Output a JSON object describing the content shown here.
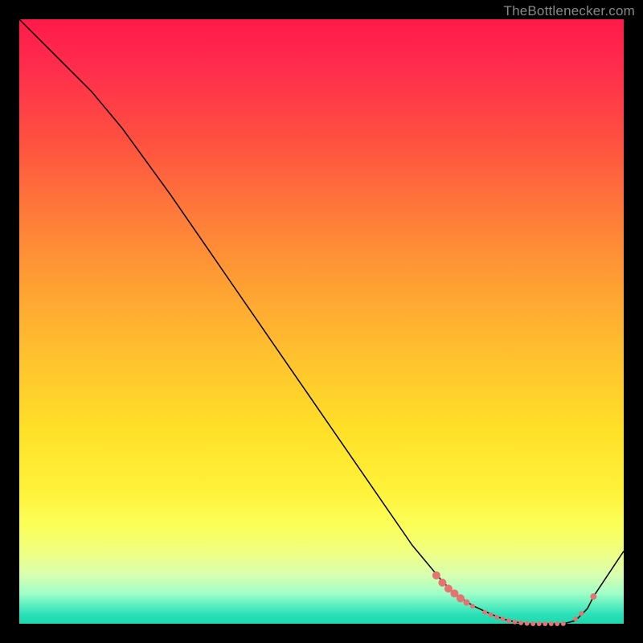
{
  "watermark": "TheBottlenecker.com",
  "chart_data": {
    "type": "line",
    "title": "",
    "xlabel": "",
    "ylabel": "",
    "xlim": [
      0,
      100
    ],
    "ylim": [
      0,
      100
    ],
    "x": [
      0,
      4,
      8,
      12,
      17,
      25,
      35,
      45,
      55,
      65,
      70,
      72,
      75,
      78,
      80,
      82,
      84,
      87,
      90,
      92,
      94,
      95,
      100
    ],
    "y": [
      100,
      96,
      92,
      88,
      82,
      71,
      56.5,
      42,
      27.5,
      13,
      7,
      5,
      3,
      1.6,
      0.8,
      0.3,
      0.0,
      0.0,
      0.0,
      0.5,
      2.5,
      4.5,
      12
    ],
    "series": [
      {
        "name": "curve",
        "x": [
          0,
          4,
          8,
          12,
          17,
          25,
          35,
          45,
          55,
          65,
          70,
          72,
          75,
          78,
          80,
          82,
          84,
          87,
          90,
          92,
          94,
          95,
          100
        ],
        "y": [
          100,
          96,
          92,
          88,
          82,
          71,
          56.5,
          42,
          27.5,
          13,
          7,
          5,
          3,
          1.6,
          0.8,
          0.3,
          0.0,
          0.0,
          0.0,
          0.5,
          2.5,
          4.5,
          12
        ]
      }
    ],
    "dots": [
      {
        "x": 69,
        "y": 8.0,
        "r": 5
      },
      {
        "x": 70,
        "y": 6.8,
        "r": 5
      },
      {
        "x": 71,
        "y": 5.8,
        "r": 5
      },
      {
        "x": 72,
        "y": 5.0,
        "r": 5
      },
      {
        "x": 73,
        "y": 4.2,
        "r": 5
      },
      {
        "x": 74,
        "y": 3.5,
        "r": 4
      },
      {
        "x": 75,
        "y": 2.9,
        "r": 3
      },
      {
        "x": 77,
        "y": 1.9,
        "r": 3
      },
      {
        "x": 78,
        "y": 1.5,
        "r": 3
      },
      {
        "x": 79,
        "y": 1.1,
        "r": 3
      },
      {
        "x": 80,
        "y": 0.8,
        "r": 3
      },
      {
        "x": 81,
        "y": 0.5,
        "r": 3
      },
      {
        "x": 82,
        "y": 0.3,
        "r": 3
      },
      {
        "x": 83,
        "y": 0.15,
        "r": 3
      },
      {
        "x": 84,
        "y": 0.05,
        "r": 3
      },
      {
        "x": 85,
        "y": 0.0,
        "r": 3
      },
      {
        "x": 86,
        "y": 0.0,
        "r": 3
      },
      {
        "x": 87,
        "y": 0.0,
        "r": 3
      },
      {
        "x": 88,
        "y": 0.0,
        "r": 3
      },
      {
        "x": 89,
        "y": 0.0,
        "r": 3
      },
      {
        "x": 90,
        "y": 0.02,
        "r": 3
      },
      {
        "x": 92,
        "y": 0.8,
        "r": 3
      },
      {
        "x": 93,
        "y": 1.7,
        "r": 3
      },
      {
        "x": 95,
        "y": 4.5,
        "r": 4
      }
    ]
  }
}
